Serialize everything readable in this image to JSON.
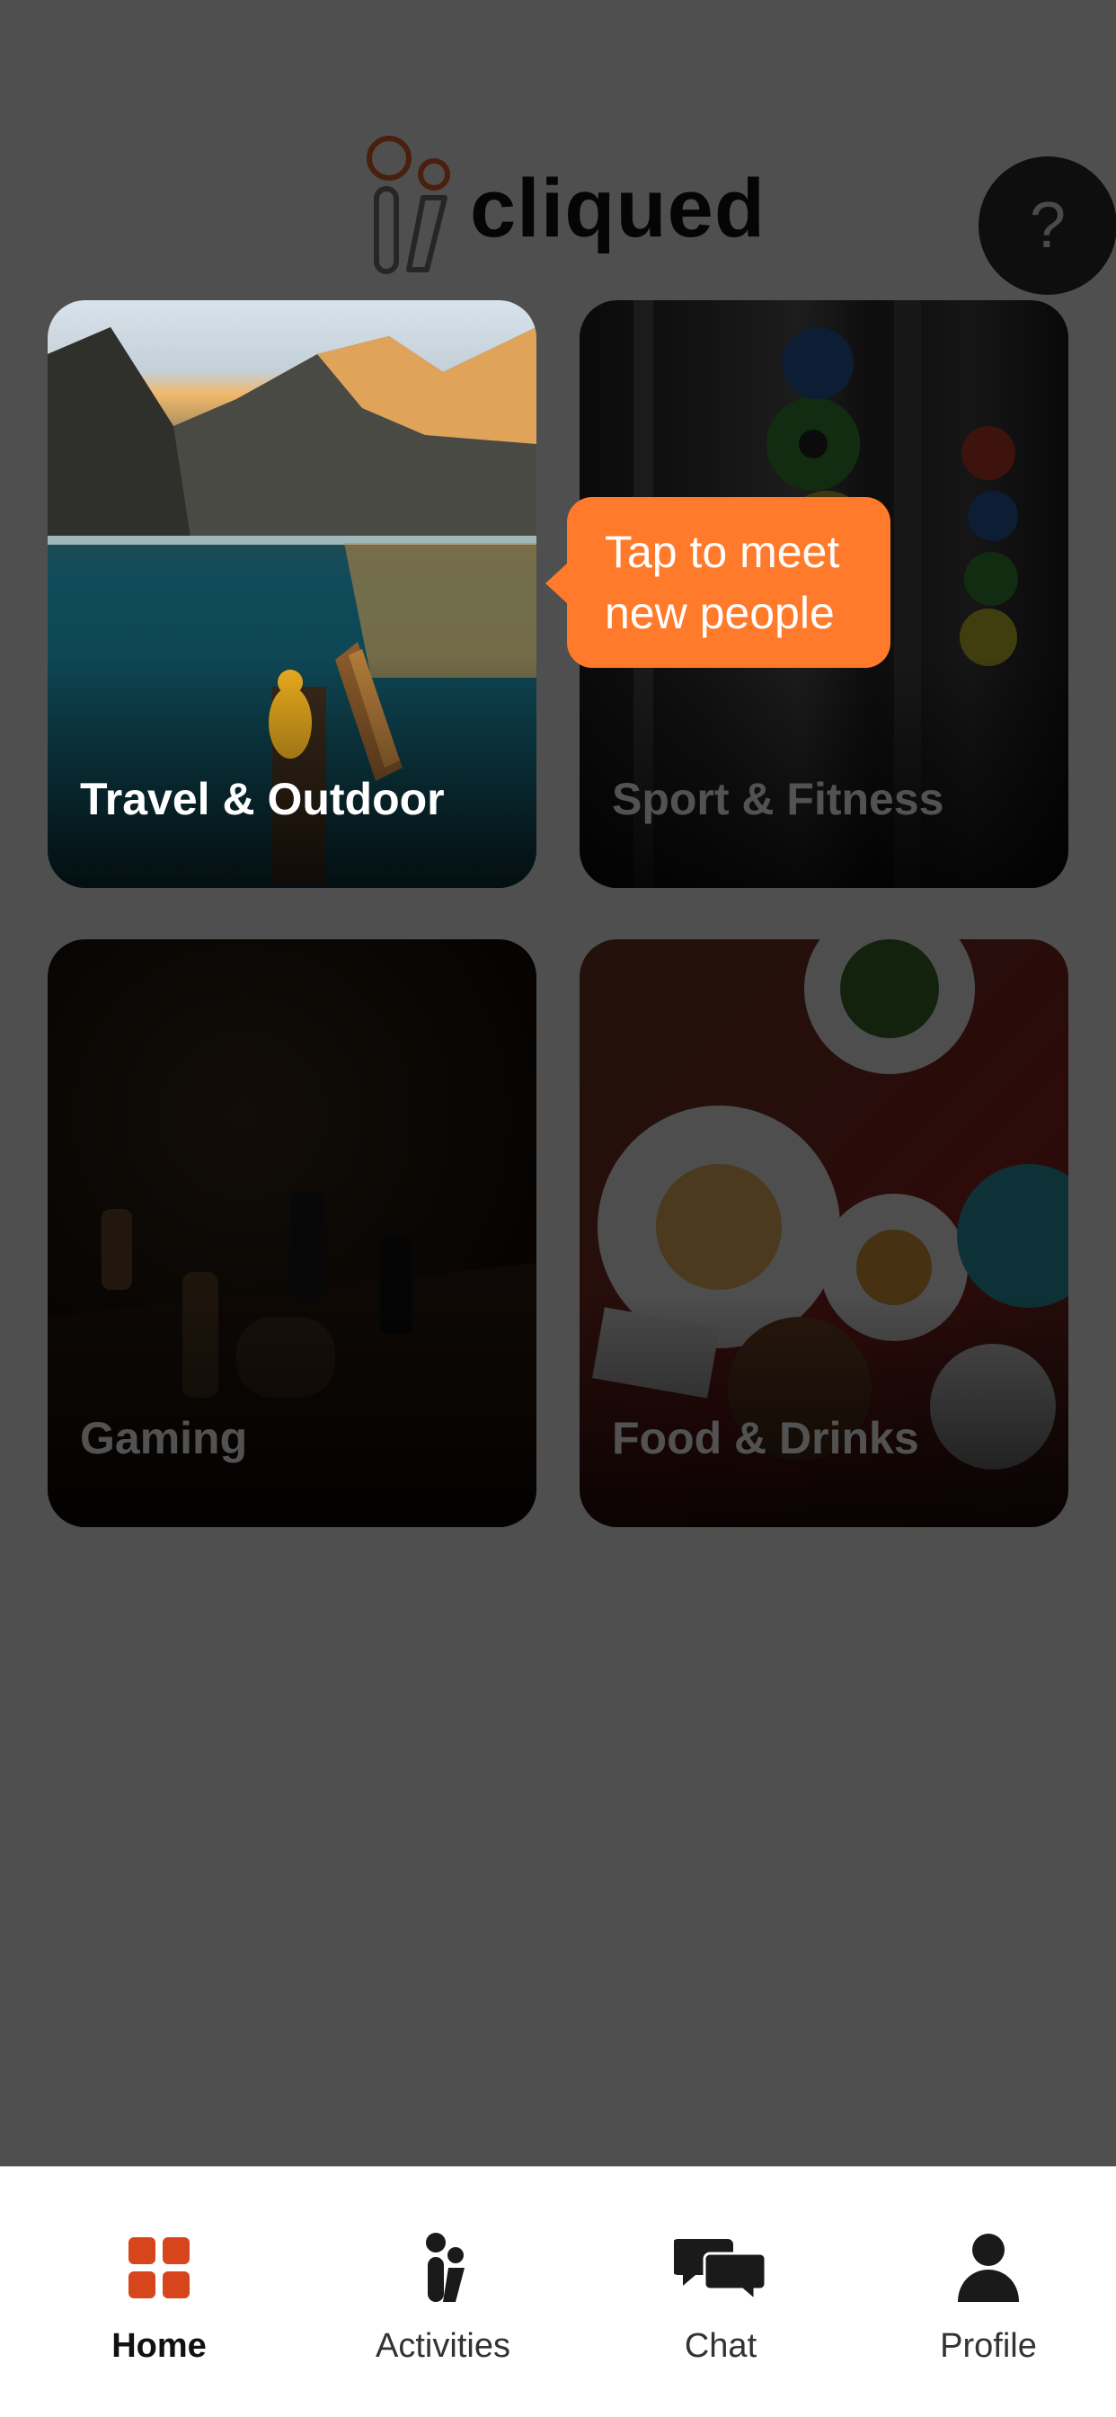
{
  "app": {
    "title": "cliqued"
  },
  "header": {
    "help_label": "?"
  },
  "categories": [
    {
      "label": "Travel & Outdoor"
    },
    {
      "label": "Sport & Fitness"
    },
    {
      "label": "Gaming"
    },
    {
      "label": "Food & Drinks"
    }
  ],
  "tooltip": {
    "line1": "Tap to meet",
    "line2": "new people"
  },
  "nav": {
    "items": [
      {
        "label": "Home",
        "icon": "grid-icon"
      },
      {
        "label": "Activities",
        "icon": "people-icon"
      },
      {
        "label": "Chat",
        "icon": "chat-bubbles-icon"
      },
      {
        "label": "Profile",
        "icon": "person-icon"
      }
    ]
  },
  "colors": {
    "accent": "#ff7a2a",
    "nav_active": "#d6451b",
    "logo_ring": "#e2602c"
  }
}
